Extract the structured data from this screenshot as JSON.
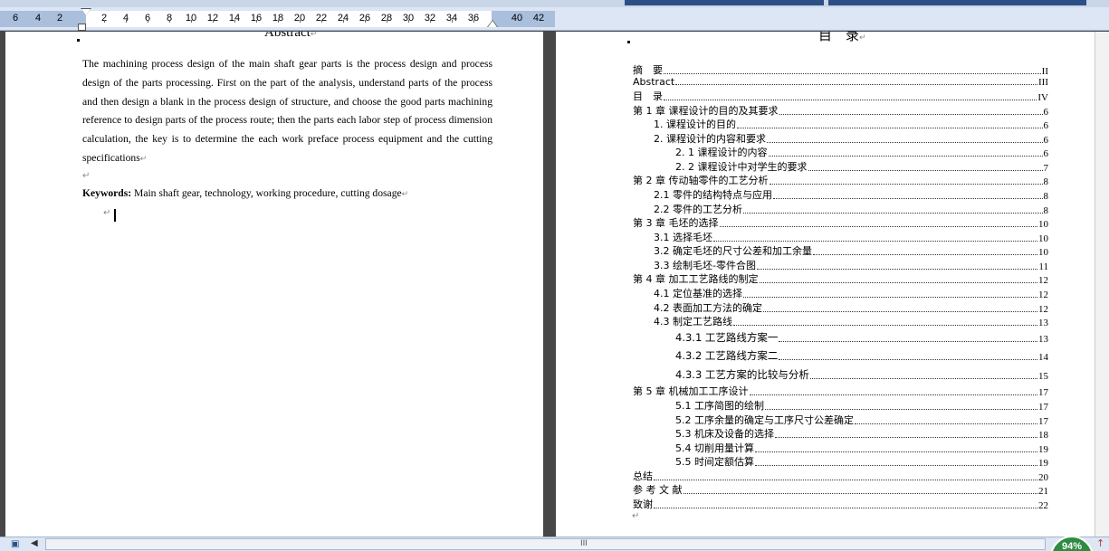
{
  "ruler": {
    "numbers": [
      "6",
      "4",
      "2",
      "2",
      "4",
      "6",
      "8",
      "10",
      "12",
      "14",
      "16",
      "18",
      "20",
      "22",
      "24",
      "26",
      "28",
      "30",
      "32",
      "34",
      "36",
      "40",
      "42"
    ]
  },
  "abstract": {
    "title": "Abstract",
    "body": "The machining process design of the main shaft gear parts is the process design and process design of the parts processing. First on the part of the analysis, understand parts of the process and then design a blank in the process design of structure, and choose the good parts machining reference to design parts of the process route; then the parts each labor step of process dimension calculation, the key is to determine the each work preface process equipment and the cutting specifications",
    "keywords_label": "Keywords:",
    "keywords": " Main shaft gear, technology, working procedure, cutting dosage",
    "paragraph_mark": "↵"
  },
  "toc": {
    "title": "目　录",
    "entries": [
      {
        "label": "摘　要",
        "page": "II"
      },
      {
        "label": "Abstract",
        "page": "III"
      },
      {
        "label": "目　录",
        "page": "IV"
      },
      {
        "label": "第 1 章  课程设计的目的及其要求",
        "page": "6"
      },
      {
        "label": "1. 课程设计的目的",
        "page": "6"
      },
      {
        "label": "2. 课程设计的内容和要求",
        "page": "6"
      },
      {
        "label": "2. 1 课程设计的内容",
        "page": "6"
      },
      {
        "label": "2. 2 课程设计中对学生的要求",
        "page": "7"
      },
      {
        "label": "第 2 章  传动轴零件的工艺分析",
        "page": "8"
      },
      {
        "label": "2.1 零件的结构特点与应用",
        "page": "8"
      },
      {
        "label": "2.2 零件的工艺分析",
        "page": "8"
      },
      {
        "label": "第 3 章    毛坯的选择",
        "page": "10"
      },
      {
        "label": "3.1    选择毛坯",
        "page": "10"
      },
      {
        "label": "3.2    确定毛坯的尺寸公差和加工余量",
        "page": "10"
      },
      {
        "label": "3.3    绘制毛坯-零件合图",
        "page": "11"
      },
      {
        "label": "第 4 章  加工工艺路线的制定",
        "page": "12"
      },
      {
        "label": "4.1  定位基准的选择",
        "page": "12"
      },
      {
        "label": "4.2  表面加工方法的确定",
        "page": "12"
      },
      {
        "label": "4.3  制定工艺路线",
        "page": "13"
      },
      {
        "label": "4.3.1  工艺路线方案一",
        "page": "13"
      },
      {
        "label": "4.3.2  工艺路线方案二",
        "page": "14"
      },
      {
        "label": "4.3.3  工艺方案的比较与分析",
        "page": "15"
      },
      {
        "label": "第 5 章    机械加工工序设计",
        "page": "17"
      },
      {
        "label": "5.1  工序简图的绘制",
        "page": "17"
      },
      {
        "label": "5.2 工序余量的确定与工序尺寸公差确定",
        "page": "17"
      },
      {
        "label": "5.3  机床及设备的选择",
        "page": "18"
      },
      {
        "label": "5.4 切削用量计算",
        "page": "19"
      },
      {
        "label": "5.5 时间定额估算",
        "page": "19"
      },
      {
        "label": "总结",
        "page": "20"
      },
      {
        "label": "参  考  文  献",
        "page": "21"
      },
      {
        "label": "致谢",
        "page": "22"
      }
    ]
  },
  "status": {
    "zoom": "94%",
    "scroll_grip": "III"
  }
}
